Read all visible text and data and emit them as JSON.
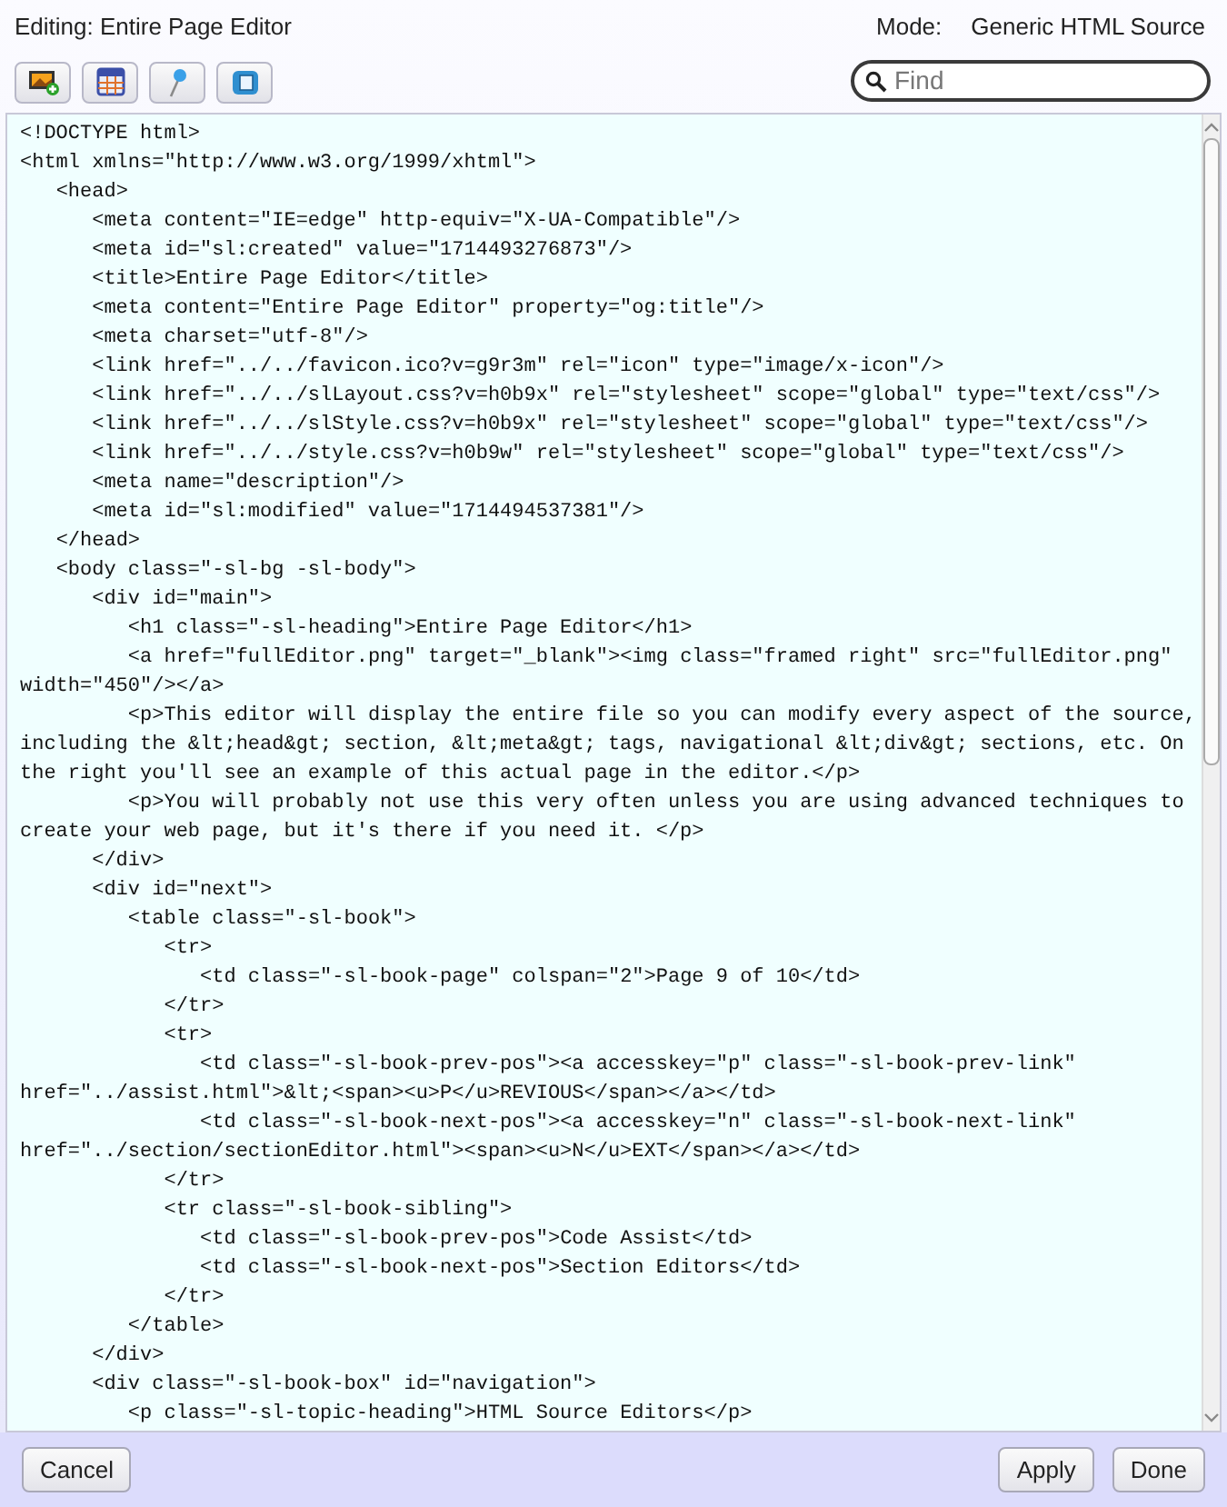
{
  "header": {
    "title": "Editing: Entire Page Editor",
    "mode_label": "Mode:",
    "mode_value": "Generic HTML Source"
  },
  "toolbar": {
    "search": {
      "placeholder": "Find"
    }
  },
  "editor": {
    "lines": [
      "<!DOCTYPE html>",
      "<html xmlns=\"http://www.w3.org/1999/xhtml\">",
      "   <head>",
      "      <meta content=\"IE=edge\" http-equiv=\"X-UA-Compatible\"/>",
      "      <meta id=\"sl:created\" value=\"1714493276873\"/>",
      "      <title>Entire Page Editor</title>",
      "      <meta content=\"Entire Page Editor\" property=\"og:title\"/>",
      "      <meta charset=\"utf-8\"/>",
      "      <link href=\"../../favicon.ico?v=g9r3m\" rel=\"icon\" type=\"image/x-icon\"/>",
      "      <link href=\"../../slLayout.css?v=h0b9x\" rel=\"stylesheet\" scope=\"global\" type=\"text/css\"/>",
      "      <link href=\"../../slStyle.css?v=h0b9x\" rel=\"stylesheet\" scope=\"global\" type=\"text/css\"/>",
      "      <link href=\"../../style.css?v=h0b9w\" rel=\"stylesheet\" scope=\"global\" type=\"text/css\"/>",
      "      <meta name=\"description\"/>",
      "      <meta id=\"sl:modified\" value=\"1714494537381\"/>",
      "   </head>",
      "   <body class=\"-sl-bg -sl-body\">",
      "      <div id=\"main\">",
      "         <h1 class=\"-sl-heading\">Entire Page Editor</h1>",
      "         <a href=\"fullEditor.png\" target=\"_blank\"><img class=\"framed right\" src=\"fullEditor.png\" width=\"450\"/></a>",
      "         <p>This editor will display the entire file so you can modify every aspect of the source, including the &lt;head&gt; section, &lt;meta&gt; tags, navigational &lt;div&gt; sections, etc. On the right you'll see an example of this actual page in the editor.</p>",
      "         <p>You will probably not use this very often unless you are using advanced techniques to create your web page, but it's there if you need it. </p>",
      "      </div>",
      "      <div id=\"next\">",
      "         <table class=\"-sl-book\">",
      "            <tr>",
      "               <td class=\"-sl-book-page\" colspan=\"2\">Page 9 of 10</td>",
      "            </tr>",
      "            <tr>",
      "               <td class=\"-sl-book-prev-pos\"><a accesskey=\"p\" class=\"-sl-book-prev-link\" href=\"../assist.html\">&lt;<span><u>P</u>REVIOUS</span></a></td>",
      "               <td class=\"-sl-book-next-pos\"><a accesskey=\"n\" class=\"-sl-book-next-link\" href=\"../section/sectionEditor.html\"><span><u>N</u>EXT</span></a></td>",
      "            </tr>",
      "            <tr class=\"-sl-book-sibling\">",
      "               <td class=\"-sl-book-prev-pos\">Code Assist</td>",
      "               <td class=\"-sl-book-next-pos\">Section Editors</td>",
      "            </tr>",
      "         </table>",
      "      </div>",
      "      <div class=\"-sl-book-box\" id=\"navigation\">",
      "         <p class=\"-sl-topic-heading\">HTML Source Editors</p>"
    ]
  },
  "footer": {
    "buttons": [
      {
        "label": "Cancel"
      },
      {
        "label": "Apply"
      },
      {
        "label": "Done"
      }
    ]
  }
}
